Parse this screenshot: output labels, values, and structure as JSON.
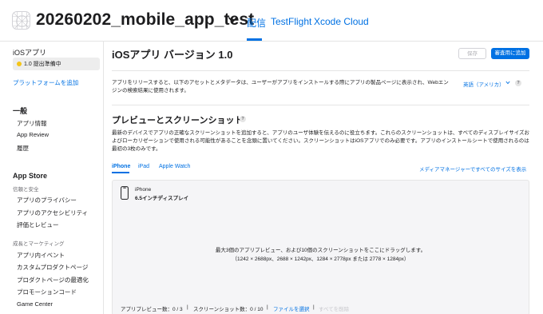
{
  "header": {
    "app_name": "20260202_mobile_app_test",
    "tabs": [
      {
        "label": "配信",
        "active": true
      },
      {
        "label": "TestFlight",
        "active": false
      },
      {
        "label": "Xcode Cloud",
        "active": false
      }
    ]
  },
  "sidebar": {
    "ios_app_title": "iOSアプリ",
    "version_status": "1.0 提出準備中",
    "add_platform": "プラットフォームを追加",
    "general": {
      "heading": "一般",
      "items": [
        "アプリ情報",
        "App Review",
        "履歴"
      ]
    },
    "app_store": {
      "heading": "App Store",
      "trust_safety_label": "信頼と安全",
      "trust_items": [
        "アプリのプライバシー",
        "アプリのアクセシビリティ",
        "評価とレビュー"
      ],
      "growth_label": "成長とマーケティング",
      "growth_items": [
        "アプリ内イベント",
        "カスタムプロダクトページ",
        "プロダクトページの最適化",
        "プロモーションコード",
        "Game Center"
      ]
    }
  },
  "main": {
    "title": "iOSアプリ バージョン 1.0",
    "save_button": "保存",
    "submit_button": "審査用に追加",
    "description": "アプリをリリースすると、以下のアセットとメタデータは、ユーザーがアプリをインストールする際にアプリの製品ページに表示され、Webエンジンの検索結果に使用されます。",
    "language": "英語（アメリカ）",
    "help_glyph": "?",
    "preview_section": {
      "title": "プレビューとスクリーンショット",
      "description": "最新のデバイスでアプリの正確なスクリーンショットを追加すると、アプリのユーザ体験を伝えるのに役立ちます。これらのスクリーンショットは、すべてのディスプレイサイズおよびローカリゼーションで使用される可能性があることを念頭に置いてください。スクリーンショットはiOSアプリでのみ必要です。アプリのインストールシートで使用されるのは最初の3枚のみです。",
      "device_tabs": [
        {
          "label": "iPhone",
          "active": true
        },
        {
          "label": "iPad",
          "active": false
        },
        {
          "label": "Apple Watch",
          "active": false
        }
      ],
      "media_manager_link": "メディアマネージャーですべてのサイズを表示",
      "device_type": "iPhone",
      "device_size": "6.5インチディスプレイ",
      "drop_main": "最大3個のアプリプレビュー、および10個のスクリーンショットをここにドラッグします。",
      "drop_sizes": "（1242 × 2688px、2688 × 1242px、1284 × 2778px または 2778 × 1284px）",
      "preview_count": "アプリプレビュー数：0 / 3",
      "screenshot_count": "スクリーンショット数：0 / 10",
      "separator": "|",
      "choose_file": "ファイルを選択",
      "delete_all": "すべてを削除"
    }
  },
  "colors": {
    "accent": "#0071e3",
    "status_yellow": "#f5c518",
    "text": "#1d1d1f",
    "muted": "#6e6e73"
  }
}
